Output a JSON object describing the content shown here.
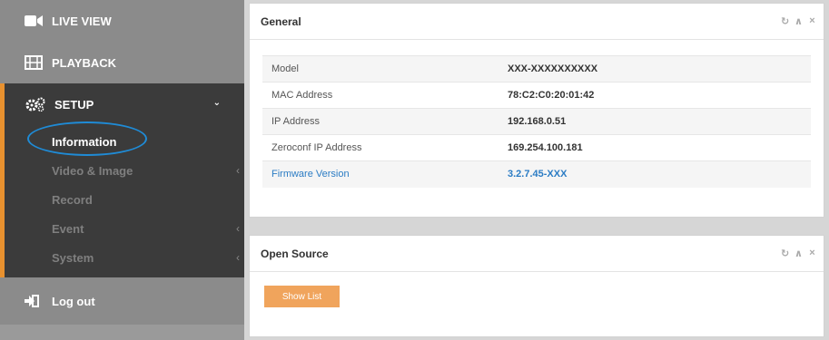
{
  "sidebar": {
    "live_view": "LIVE VIEW",
    "playback": "PLAYBACK",
    "setup": "SETUP",
    "sub_items": [
      "Information",
      "Video & Image",
      "Record",
      "Event",
      "System"
    ],
    "logout": "Log out",
    "accent_color": "#e8912f",
    "highlight_color": "#1f8bd6"
  },
  "general": {
    "title": "General",
    "rows": [
      {
        "key": "Model",
        "value": "XXX-XXXXXXXXXX"
      },
      {
        "key": "MAC Address",
        "value": "78:C2:C0:20:01:42"
      },
      {
        "key": "IP Address",
        "value": "192.168.0.51"
      },
      {
        "key": "Zeroconf IP Address",
        "value": "169.254.100.181"
      },
      {
        "key": "Firmware Version",
        "value": "3.2.7.45-XXX"
      }
    ]
  },
  "open_source": {
    "title": "Open Source",
    "button": "Show List"
  },
  "tools": {
    "refresh": "↻",
    "collapse": "∧",
    "close": "×"
  }
}
